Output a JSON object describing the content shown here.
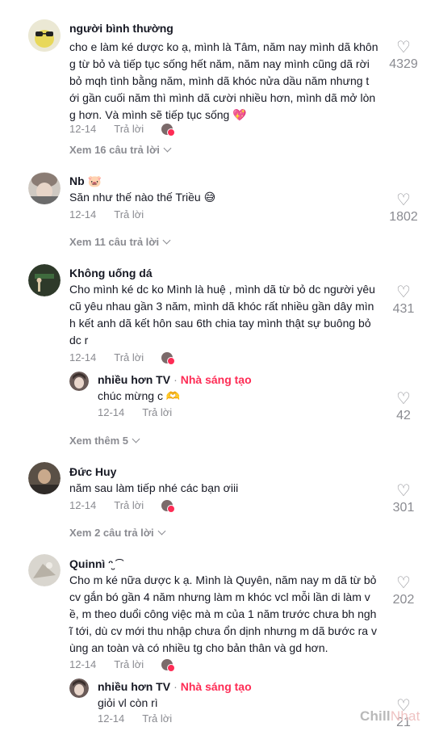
{
  "comments": [
    {
      "name": "người bình thường",
      "lines": [
        "cho e làm ké dược ko ạ, mình là Tâm, năm nay mình dã khôn",
        "g từ bỏ và tiếp tục sống hết năm, năm nay mình cũng dã rời",
        "bỏ mqh tình bằng năm, mình dã khóc nửa dầu năm nhưng t",
        "ới gần cuối năm thì mình dã cười nhiều hơn, mình dã mở lòn",
        "g hơn. Và mình sẽ tiếp tục sống 💖"
      ],
      "date": "12-14",
      "reply_label": "Trả lời",
      "likes": "4329",
      "view_more": "Xem 16 câu trả lời"
    },
    {
      "name": "Nb 🐷",
      "lines": [
        "Săn như thế nào thế Triều 😅"
      ],
      "date": "12-14",
      "reply_label": "Trả lời",
      "likes": "1802",
      "view_more": "Xem 11 câu trả lời"
    },
    {
      "name": "Không uống dá",
      "lines": [
        "Cho mình ké dc ko Mình là huệ , mình dã từ bỏ dc người yêu",
        "cũ yêu nhau gần 3 năm, mình dã khóc rất nhiều gần dây mìn",
        "h kết anh dã kết hôn sau 6th chia tay mình thật sự buông bỏ",
        "dc r"
      ],
      "date": "12-14",
      "reply_label": "Trả lời",
      "likes": "431",
      "reply": {
        "name": "nhiều hơn TV",
        "creator": "Nhà sáng tạo",
        "text": "chúc mừng c 🫶",
        "date": "12-14",
        "reply_label": "Trả lời",
        "likes": "42"
      },
      "view_more": "Xem thêm 5"
    },
    {
      "name": "Đức Huy",
      "lines": [
        "năm sau làm tiếp nhé các bạn ơiii"
      ],
      "date": "12-14",
      "reply_label": "Trả lời",
      "likes": "301",
      "view_more": "Xem 2 câu trả lời"
    },
    {
      "name": "Quinnì ᵔ̮ ͡",
      "lines": [
        "Cho m ké nữa dược k ạ. Mình là Quyên, năm nay m dã từ bỏ",
        "cv gắn bó gần 4 năm nhưng làm m khóc vcl mỗi lần di làm v",
        "ề, m theo duổi công việc mà m của 1 năm trước chưa bh ngh",
        "ĩ tới, dù cv mới thu nhập chưa ổn dịnh nhưng m dã bước ra v",
        "ùng an toàn và có nhiều tg cho bản thân và gd hơn."
      ],
      "date": "12-14",
      "reply_label": "Trả lời",
      "likes": "202",
      "reply": {
        "name": "nhiều hơn TV",
        "creator": "Nhà sáng tạo",
        "text": "giỏi vl còn rì",
        "date": "12-14",
        "reply_label": "Trả lời",
        "likes": "21"
      }
    }
  ],
  "watermark": {
    "a": "Chill",
    "b": "Nhat"
  },
  "colors": {
    "accent": "#fe2c55",
    "muted": "#8a8b91",
    "text": "#161823"
  },
  "icons": {
    "like": "heart-outline-icon",
    "expand": "chevron-down-icon"
  }
}
